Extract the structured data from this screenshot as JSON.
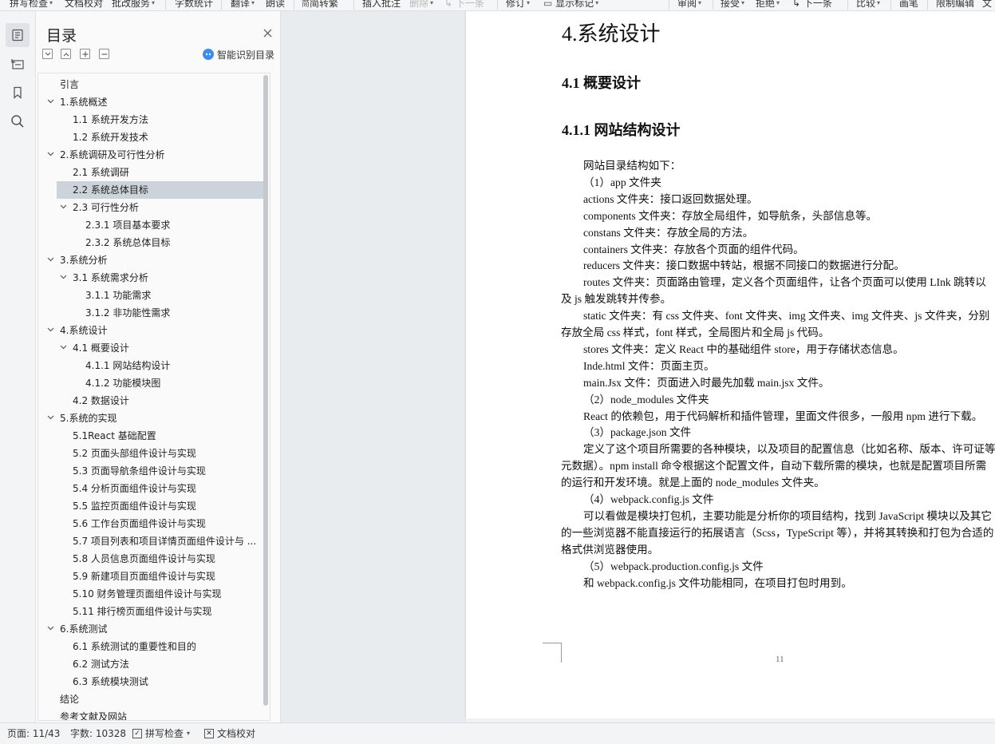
{
  "toolbar": {
    "items": [
      {
        "label": "拼写检查",
        "caret": true,
        "disabled": false
      },
      {
        "label": "文档校对",
        "caret": false,
        "disabled": false
      },
      {
        "label": "批改服务",
        "caret": true,
        "disabled": false
      },
      {
        "label": "字数统计",
        "caret": false,
        "disabled": false
      },
      {
        "label": "翻译",
        "caret": true,
        "disabled": false
      },
      {
        "label": "朗读",
        "caret": false,
        "disabled": false
      },
      {
        "label": "简转繁",
        "caret": false,
        "disabled": false
      },
      {
        "label": "插入批注",
        "caret": false,
        "disabled": false
      },
      {
        "label": "删除",
        "caret": true,
        "disabled": true
      },
      {
        "label": "下一条",
        "caret": false,
        "disabled": true
      },
      {
        "label": "修订",
        "caret": true,
        "disabled": false
      },
      {
        "label": "显示标记",
        "caret": true,
        "disabled": false
      },
      {
        "label": "审阅",
        "caret": true,
        "disabled": false
      },
      {
        "label": "接受",
        "caret": true,
        "disabled": false
      },
      {
        "label": "拒绝",
        "caret": true,
        "disabled": false
      },
      {
        "label": "下一条",
        "caret": false,
        "disabled": false
      },
      {
        "label": "比较",
        "caret": true,
        "disabled": false
      },
      {
        "label": "画笔",
        "caret": false,
        "disabled": false
      },
      {
        "label": "限制编辑",
        "caret": false,
        "disabled": false
      },
      {
        "label": "文",
        "caret": false,
        "disabled": false
      }
    ]
  },
  "sidebar": {
    "icons": [
      "toc-icon",
      "navigation-icon",
      "bookmark-icon",
      "search-icon"
    ]
  },
  "toc": {
    "title": "目录",
    "smart_label": "智能识别目录",
    "items": [
      {
        "label": "引言",
        "level": 0,
        "caret": ""
      },
      {
        "label": "1.系统概述",
        "level": 0,
        "caret": "open"
      },
      {
        "label": "1.1  系统开发方法",
        "level": 1,
        "caret": ""
      },
      {
        "label": "1.2  系统开发技术",
        "level": 1,
        "caret": ""
      },
      {
        "label": "2.系统调研及可行性分析",
        "level": 0,
        "caret": "open"
      },
      {
        "label": "2.1 系统调研",
        "level": 1,
        "caret": ""
      },
      {
        "label": "2.2 系统总体目标",
        "level": 1,
        "caret": "",
        "selected": true
      },
      {
        "label": "2.3 可行性分析",
        "level": 1,
        "caret": "open"
      },
      {
        "label": "2.3.1 项目基本要求",
        "level": 2,
        "caret": ""
      },
      {
        "label": "2.3.2 系统总体目标",
        "level": 2,
        "caret": ""
      },
      {
        "label": "3.系统分析",
        "level": 0,
        "caret": "open"
      },
      {
        "label": "3.1 系统需求分析",
        "level": 1,
        "caret": "open"
      },
      {
        "label": "3.1.1 功能需求",
        "level": 2,
        "caret": ""
      },
      {
        "label": "3.1.2 非功能性需求",
        "level": 2,
        "caret": ""
      },
      {
        "label": "4.系统设计",
        "level": 0,
        "caret": "open"
      },
      {
        "label": "4.1 概要设计",
        "level": 1,
        "caret": "open"
      },
      {
        "label": "4.1.1 网站结构设计",
        "level": 2,
        "caret": ""
      },
      {
        "label": "4.1.2 功能模块图",
        "level": 2,
        "caret": ""
      },
      {
        "label": "4.2 数据设计",
        "level": 1,
        "caret": ""
      },
      {
        "label": "5.系统的实现",
        "level": 0,
        "caret": "open"
      },
      {
        "label": "5.1React 基础配置",
        "level": 1,
        "caret": ""
      },
      {
        "label": "5.2 页面头部组件设计与实现",
        "level": 1,
        "caret": ""
      },
      {
        "label": "5.3 页面导航条组件设计与实现",
        "level": 1,
        "caret": ""
      },
      {
        "label": "5.4 分析页面组件设计与实现",
        "level": 1,
        "caret": ""
      },
      {
        "label": "5.5 监控页面组件设计与实现",
        "level": 1,
        "caret": ""
      },
      {
        "label": "5.6 工作台页面组件设计与实现",
        "level": 1,
        "caret": ""
      },
      {
        "label": "5.7 项目列表和项目详情页面组件设计与 ...",
        "level": 1,
        "caret": ""
      },
      {
        "label": "5.8 人员信息页面组件设计与实现",
        "level": 1,
        "caret": ""
      },
      {
        "label": "5.9 新建项目页面组件设计与实现",
        "level": 1,
        "caret": ""
      },
      {
        "label": "5.10 财务管理页面组件设计与实现",
        "level": 1,
        "caret": ""
      },
      {
        "label": "5.11 排行榜页面组件设计与实现",
        "level": 1,
        "caret": ""
      },
      {
        "label": "6.系统测试",
        "level": 0,
        "caret": "open"
      },
      {
        "label": "6.1 系统测试的重要性和目的",
        "level": 1,
        "caret": ""
      },
      {
        "label": "6.2 测试方法",
        "level": 1,
        "caret": ""
      },
      {
        "label": "6.3 系统模块测试",
        "level": 1,
        "caret": ""
      },
      {
        "label": "结论",
        "level": 0,
        "caret": ""
      },
      {
        "label": "参考文献及网站",
        "level": 0,
        "caret": ""
      }
    ]
  },
  "document": {
    "chapter": "4.系统设计",
    "h2": "4.1 概要设计",
    "h3": "4.1.1 网站结构设计",
    "page_number": "11",
    "lines": [
      {
        "text": "网站目录结构如下：",
        "indent": true
      },
      {
        "text": "（1）app 文件夹",
        "indent": true
      },
      {
        "text": "actions 文件夹：接口返回数据处理。",
        "indent": true
      },
      {
        "text": "components 文件夹：存放全局组件，如导航条，头部信息等。",
        "indent": true
      },
      {
        "text": "constans 文件夹：存放全局的方法。",
        "indent": true
      },
      {
        "text": "containers 文件夹：存放各个页面的组件代码。",
        "indent": true
      },
      {
        "text": "reducers 文件夹：接口数据中转站，根据不同接口的数据进行分配。",
        "indent": true
      },
      {
        "text": "routes 文件夹：页面路由管理，定义各个页面组件，让各个页面可以使用 LInk 跳转以",
        "indent": true
      },
      {
        "text": "及 js 触发跳转并传参。",
        "indent": false
      },
      {
        "text": "static 文件夹：有 css 文件夹、font 文件夹、img 文件夹、img 文件夹、js 文件夹，分别",
        "indent": true
      },
      {
        "text": "存放全局 css 样式，font 样式，全局图片和全局 js 代码。",
        "indent": false
      },
      {
        "text": "stores 文件夹：定义 React 中的基础组件 store，用于存储状态信息。",
        "indent": true
      },
      {
        "text": "Inde.html 文件：页面主页。",
        "indent": true
      },
      {
        "text": "main.Jsx 文件：页面进入时最先加载 main.jsx 文件。",
        "indent": true
      },
      {
        "text": "（2）node_modules 文件夹",
        "indent": true
      },
      {
        "text": "React 的依赖包，用于代码解析和插件管理，里面文件很多，一般用 npm 进行下载。",
        "indent": true
      },
      {
        "text": "（3）package.json 文件",
        "indent": true
      },
      {
        "text": "定义了这个项目所需要的各种模块，以及项目的配置信息（比如名称、版本、许可证等",
        "indent": true
      },
      {
        "text": "元数据）。npm install 命令根据这个配置文件，自动下载所需的模块，也就是配置项目所需",
        "indent": false
      },
      {
        "text": "的运行和开发环境。就是上面的 node_modules 文件夹。",
        "indent": false
      },
      {
        "text": "（4）webpack.config.js 文件",
        "indent": true
      },
      {
        "text": "可以看做是模块打包机，主要功能是分析你的项目结构，找到 JavaScript 模块以及其它",
        "indent": true
      },
      {
        "text": "的一些浏览器不能直接运行的拓展语言（Scss，TypeScript 等），并将其转换和打包为合适的",
        "indent": false
      },
      {
        "text": "格式供浏览器使用。",
        "indent": false
      },
      {
        "text": "（5）webpack.production.config.js 文件",
        "indent": true
      },
      {
        "text": "和 webpack.config.js 文件功能相同，在项目打包时用到。",
        "indent": true
      }
    ]
  },
  "status": {
    "page": "页面: 11/43",
    "words": "字数: 10328",
    "spell": "拼写检查",
    "proof": "文档校对"
  }
}
